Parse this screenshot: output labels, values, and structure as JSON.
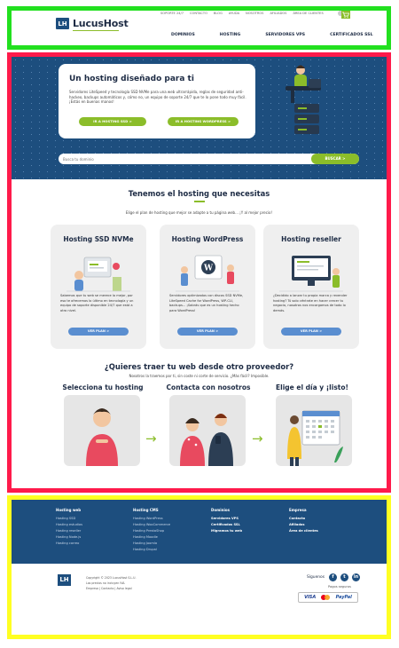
{
  "header": {
    "logo_mark": "LH",
    "logo_text": "LucusHost",
    "top_links": [
      "SOPORTE 24/7",
      "CONTACTO",
      "BLOG",
      "AYUDA",
      "NOSOTROS",
      "AFILIADOS",
      "ÁREA DE CLIENTES"
    ],
    "cart_icon": "cart-icon",
    "main_links": [
      "DOMINIOS",
      "HOSTING",
      "SERVIDORES VPS",
      "CERTIFICADOS SSL"
    ]
  },
  "hero": {
    "title": "Un hosting diseñado para ti",
    "text": "Servidores LiteSpeed y tecnología SSD NVMe para una web ultrarrápida, reglas de seguridad anti-hackeo, backups automáticos y, cómo no, un equipo de soporte 24/7 que te lo pone todo muy fácil. ¡Estás en buenas manos!",
    "btn_ssd": "IR A HOSTING SSD >",
    "btn_wp": "IR A HOSTING WORDPRESS >",
    "search_placeholder": "Busca tu dominio",
    "search_button": "BUSCAR >"
  },
  "hosting_section": {
    "title": "Tenemos el hosting que necesitas",
    "subtitle": "Elige el plan de hosting que mejor se adapte a tu página web... ¡Y al mejor precio!",
    "plans": [
      {
        "title": "Hosting SSD NVMe",
        "desc": "Sabemos que tu web se merece lo mejor, por eso te ofrecemos lo último en tecnología y un equipo de soporte disponible 24/7 que está a otro nivel.",
        "button": "VER PLAN >"
      },
      {
        "title": "Hosting WordPress",
        "desc": "Servidores optimizados con discos SSD NVMe, LiteSpeed Cache for WordPress, WP-CLI, backups... ¡Sabrás que es un hosting hecho para WordPress!",
        "button": "VER PLAN >"
      },
      {
        "title": "Hosting reseller",
        "desc": "¿Decidido a lanzar tu propia marca y revender hosting? Tú solo céntrate en hacer crecer tu negocio, nosotros nos encargamos de todo lo demás.",
        "button": "VER PLAN >"
      }
    ]
  },
  "migration_section": {
    "title": "¿Quieres traer tu web desde otro proveedor?",
    "subtitle": "Nosotros la traemos por ti, sin coste ni corte de servicio. ¿Más fácil? Imposible.",
    "steps": [
      "Selecciona tu hosting",
      "Contacta con nosotros",
      "Elige el día y ¡listo!"
    ]
  },
  "footer": {
    "columns": [
      {
        "head": "Hosting web",
        "links": [
          "Hosting SSD",
          "Hosting estudios",
          "Hosting reseller",
          "Hosting Node.js",
          "Hosting correo"
        ]
      },
      {
        "head": "Hosting CMS",
        "links": [
          "Hosting WordPress",
          "Hosting WooCommerce",
          "Hosting PrestaShop",
          "Hosting Moodle",
          "Hosting Joomla",
          "Hosting Drupal"
        ]
      },
      {
        "head": "Dominios",
        "links": [
          "Servidores VPS",
          "Certificados SSL",
          "Migramos tu web"
        ]
      },
      {
        "head": "Empresa",
        "links": [
          "Contacto",
          "Afiliados",
          "Área de clientes"
        ]
      }
    ],
    "logo_mark": "LH",
    "copyright": "Copyright © 2023 LucusHost S.L.U.",
    "copyright2": "Los precios no incluyen IVA.",
    "legal_links": "Empresa  |  Contacto  |  Aviso legal",
    "social_label": "Síguenos",
    "social_icons": [
      "facebook-icon",
      "twitter-icon",
      "linkedin-icon"
    ],
    "social_glyphs": [
      "f",
      "t",
      "in"
    ],
    "pay_label": "Pagos seguros",
    "pay_visa": "VISA",
    "pay_paypal": "PayPal"
  },
  "colors": {
    "navy": "#1d4e7e",
    "green": "#8bbd2a",
    "button_blue": "#5a8ed0",
    "frame_header": "#22e01f",
    "frame_main": "#ff1a4b",
    "frame_footer": "#ffff22"
  }
}
